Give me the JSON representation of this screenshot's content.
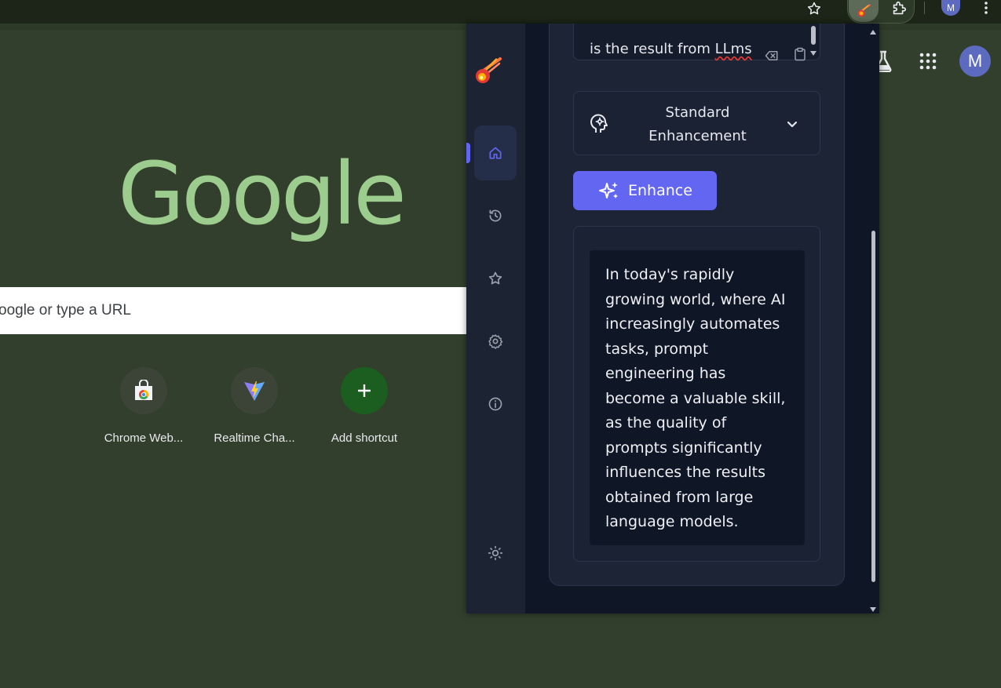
{
  "browser": {
    "profile_initial": "M"
  },
  "google": {
    "logo_text": "Google",
    "search_placeholder": "oogle or type a URL",
    "profile_initial": "M",
    "shortcuts": [
      {
        "label": "Chrome Web..."
      },
      {
        "label": "Realtime Cha..."
      },
      {
        "label": "Add shortcut"
      }
    ]
  },
  "extension": {
    "input_text_plain": "is the result from ",
    "input_text_flagged": "LLms",
    "mode_label": "Standard Enhancement",
    "enhance_label": "Enhance",
    "result_text": "In today's rapidly growing world, where AI increasingly automates tasks, prompt engineering has become a valuable skill, as the quality of prompts significantly influences the results obtained from large language models.",
    "accent_color": "#6366f1",
    "nav": [
      "home-icon",
      "history-icon",
      "star-icon",
      "gear-icon",
      "info-icon",
      "sun-icon"
    ]
  }
}
